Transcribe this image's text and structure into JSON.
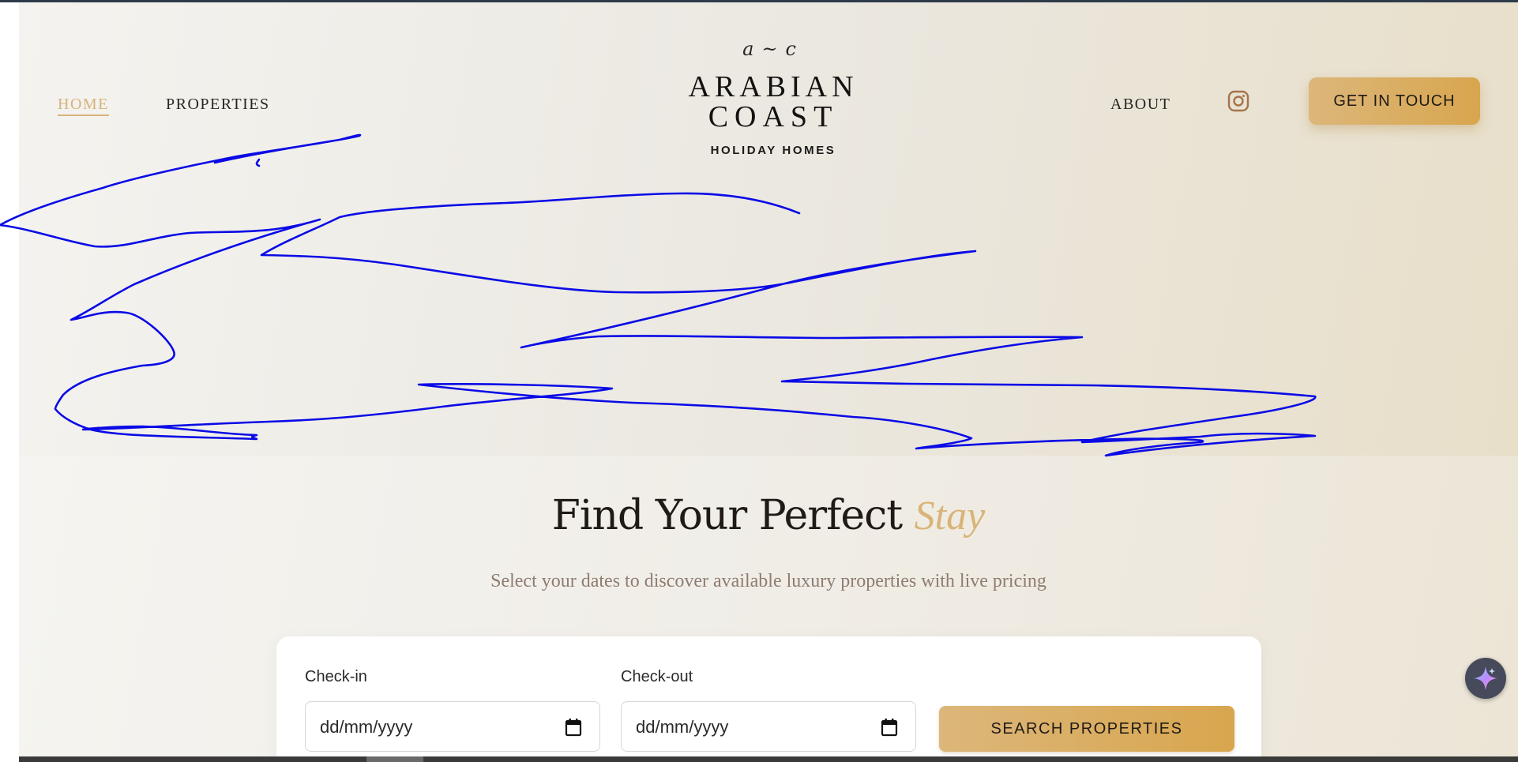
{
  "nav": {
    "home": "HOME",
    "properties": "PROPERTIES",
    "about": "ABOUT",
    "cta": "GET IN TOUCH",
    "icons": {
      "social": "instagram-icon"
    }
  },
  "logo": {
    "script": "a~c",
    "line1": "ARABIAN",
    "line2": "COAST",
    "subtitle": "HOLIDAY HOMES"
  },
  "search": {
    "title_main": "Find Your Perfect",
    "title_accent": "Stay",
    "subtitle": "Select your dates to discover available luxury properties with live pricing",
    "checkin_label": "Check-in",
    "checkin_value": "dd/mm/yyyy",
    "checkout_label": "Check-out",
    "checkout_value": "dd/mm/yyyy",
    "button": "SEARCH PROPERTIES"
  },
  "colors": {
    "accent_gold": "#d8b27a",
    "button_gold": "#d8a64e",
    "text_dark": "#1f1a16",
    "annotation_blue": "#0000ee"
  }
}
